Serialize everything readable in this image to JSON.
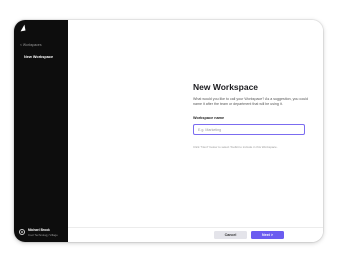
{
  "sidebar": {
    "back_label": "< Workspaces",
    "item_label": "New Workspace",
    "user_initial": "M",
    "user_name": "Michael Brook",
    "user_org": "Cool Technology Village"
  },
  "main": {
    "title": "New Workspace",
    "description": "What would you like to call your Workspace? As a suggestion, you could name it after the team or department that will be using it.",
    "field_label": "Workspace name",
    "field_placeholder": "E.g. Marketing",
    "field_value": "",
    "hint": "Click \"Next\" below to select Toolkit to include in this Workspace."
  },
  "footer": {
    "cancel_label": "Cancel",
    "next_label": "Next >"
  },
  "colors": {
    "sidebar_bg": "#0d0d0d",
    "accent": "#6b5cf0",
    "cancel_bg": "#e4e4ea"
  }
}
